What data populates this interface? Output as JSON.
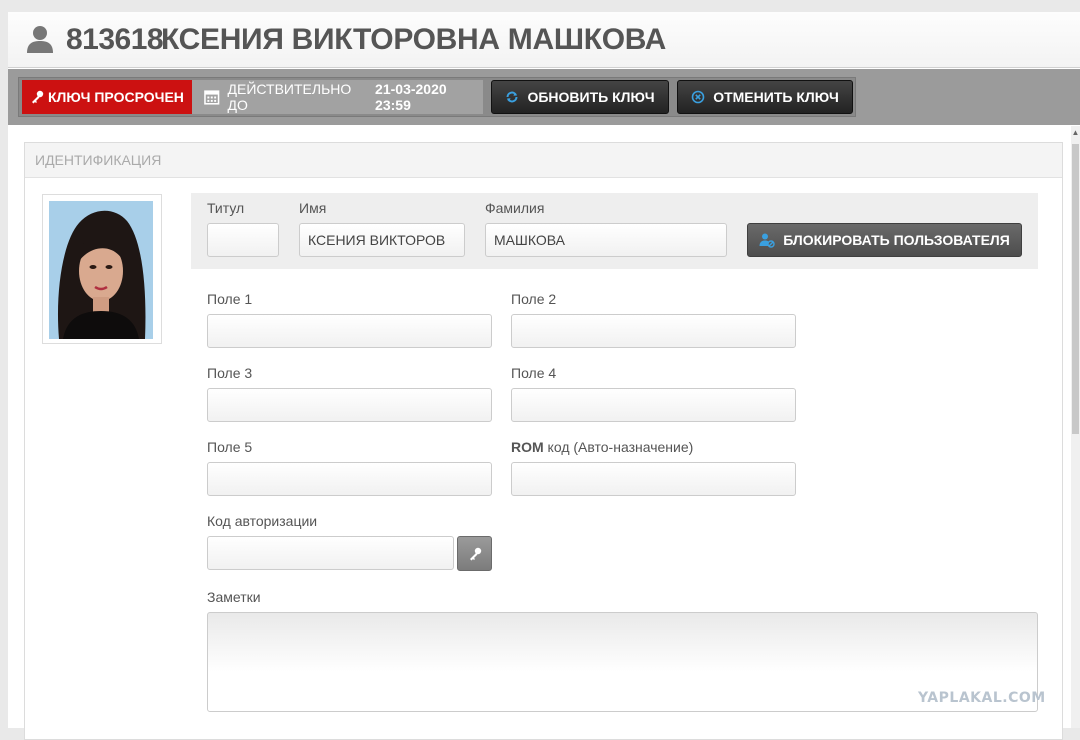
{
  "header": {
    "user_id": "813618",
    "user_name": "КСЕНИЯ ВИКТОРОВНА МАШКОВА"
  },
  "toolbar": {
    "status_label": "КЛЮЧ ПРОСРОЧЕН",
    "valid_until_label": "ДЕЙСТВИТЕЛЬНО ДО",
    "valid_until_date": "21-03-2020 23:59",
    "refresh_label": "ОБНОВИТЬ КЛЮЧ",
    "cancel_label": "ОТМЕНИТЬ КЛЮЧ",
    "status_color": "#cc1111"
  },
  "panel": {
    "title": "ИДЕНТИФИКАЦИЯ"
  },
  "identity": {
    "title_label": "Титул",
    "title_value": "",
    "first_name_label": "Имя",
    "first_name_value": "КСЕНИЯ ВИКТОРОВ",
    "last_name_label": "Фамилия",
    "last_name_value": "МАШКОВА",
    "block_label": "БЛОКИРОВАТЬ ПОЛЬЗОВАТЕЛЯ"
  },
  "fields": {
    "field1_label": "Поле 1",
    "field2_label": "Поле 2",
    "field3_label": "Поле 3",
    "field4_label": "Поле 4",
    "field5_label": "Поле 5",
    "rom_label_bold": "ROM",
    "rom_label_rest": " код (Авто-назначение)",
    "auth_label": "Код авторизации",
    "notes_label": "Заметки",
    "field1_value": "",
    "field2_value": "",
    "field3_value": "",
    "field4_value": "",
    "field5_value": "",
    "rom_value": "",
    "auth_value": ""
  },
  "watermark": "YAPLAKAL.COM"
}
